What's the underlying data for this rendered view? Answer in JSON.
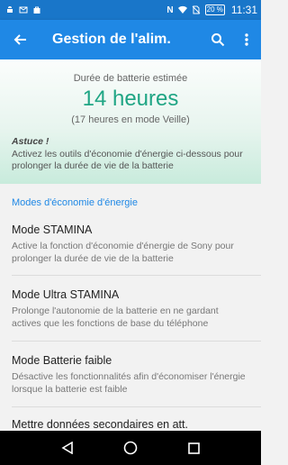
{
  "status_bar": {
    "icons": [
      "android-icon",
      "email-icon",
      "bag-icon",
      "nfc-icon",
      "wifi-icon",
      "no-sim-icon"
    ],
    "battery": "20 %",
    "time": "11:31"
  },
  "app_bar": {
    "title": "Gestion de l'alim.",
    "back_icon": "arrow-back-icon",
    "search_icon": "search-icon",
    "menu_icon": "more-vert-icon"
  },
  "estimate": {
    "label": "Durée de batterie estimée",
    "value": "14 heures",
    "standby": "(17 heures en mode Veille)",
    "tip_title": "Astuce !",
    "tip_text": "Activez les outils d'économie d'énergie ci-dessous pour prolonger la durée de vie de la batterie"
  },
  "section": {
    "title": "Modes d'économie d'énergie"
  },
  "items": [
    {
      "title": "Mode STAMINA",
      "subtitle": "Active la fonction d'économie d'énergie de Sony pour prolonger la durée de vie de la batterie"
    },
    {
      "title": "Mode Ultra STAMINA",
      "subtitle": "Prolonge l'autonomie de la batterie en ne gardant actives que les fonctions de base du téléphone"
    },
    {
      "title": "Mode Batterie faible",
      "subtitle": "Désactive les fonctionnalités afin d'économiser l'énergie lorsque la batterie est faible"
    },
    {
      "title": "Mettre données secondaires en att.",
      "subtitle": ""
    }
  ],
  "colors": {
    "status_bar": "#1976c9",
    "app_bar": "#1f88e5",
    "accent_green": "#1fa584",
    "section_blue": "#1f88e5"
  }
}
